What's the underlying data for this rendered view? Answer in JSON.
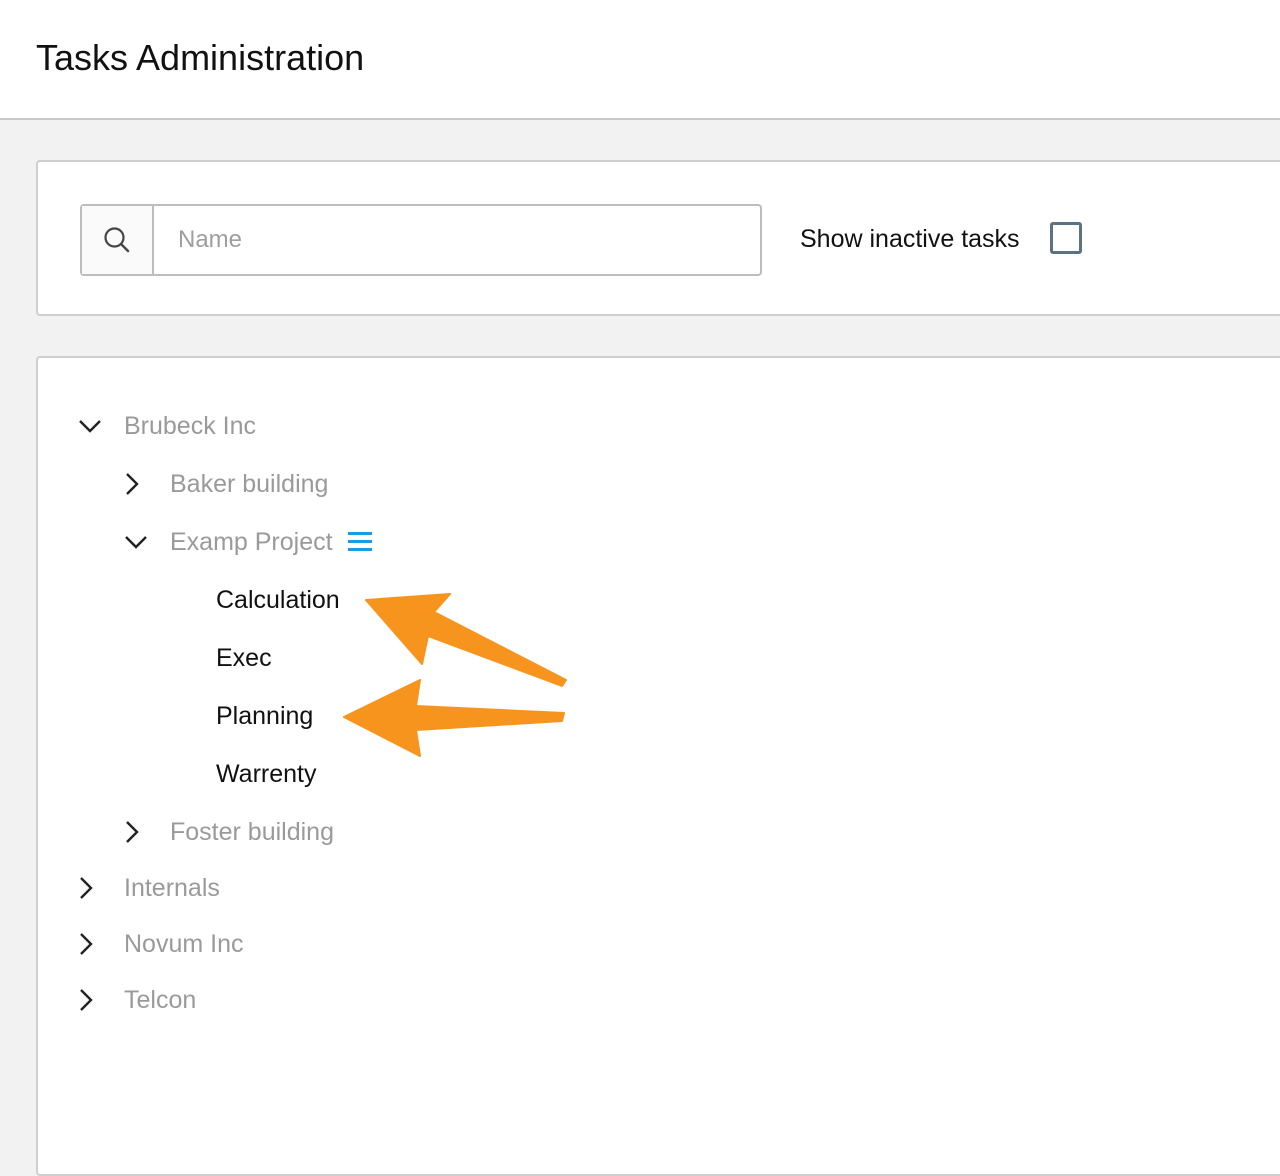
{
  "header": {
    "title": "Tasks Administration"
  },
  "filter": {
    "search_placeholder": "Name",
    "search_value": "",
    "search_icon": "search-icon",
    "show_inactive_label": "Show inactive tasks",
    "show_inactive_checked": false
  },
  "tree": {
    "brubeck": {
      "label": "Brubeck Inc",
      "expanded": true
    },
    "baker": {
      "label": "Baker building",
      "expanded": false
    },
    "examp": {
      "label": "Examp Project",
      "expanded": true,
      "icon": "menu-icon"
    },
    "tasks": [
      {
        "label": "Calculation"
      },
      {
        "label": "Exec"
      },
      {
        "label": "Planning"
      },
      {
        "label": "Warrenty"
      }
    ],
    "foster": {
      "label": "Foster building",
      "expanded": false
    },
    "internals": {
      "label": "Internals",
      "expanded": false
    },
    "novum": {
      "label": "Novum Inc",
      "expanded": false
    },
    "telcon": {
      "label": "Telcon",
      "expanded": false
    }
  },
  "colors": {
    "accent_icon": "#1a9be6",
    "annotation_arrow": "#f7941d",
    "muted_text": "#9a9a9a",
    "checkbox_border": "#5a7384"
  }
}
